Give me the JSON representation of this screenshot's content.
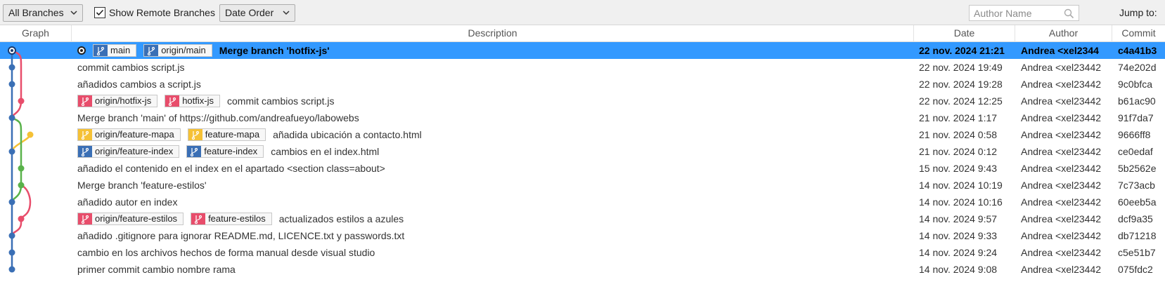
{
  "toolbar": {
    "branches_dropdown": "All Branches",
    "show_remote_label": "Show Remote Branches",
    "show_remote_checked": true,
    "order_dropdown": "Date Order",
    "author_placeholder": "Author Name",
    "jump_to_label": "Jump to:"
  },
  "columns": {
    "graph": "Graph",
    "description": "Description",
    "date": "Date",
    "author": "Author",
    "commit": "Commit"
  },
  "colors": {
    "selection": "#3399ff",
    "blue": "#3a6fb5",
    "pink": "#e84d6b",
    "yellow": "#f5c136",
    "green": "#59b24a"
  },
  "commits": [
    {
      "head": true,
      "refs": [
        {
          "name": "main",
          "color": "#3a6fb5",
          "icon": "branch-icon"
        },
        {
          "name": "origin/main",
          "color": "#3a6fb5",
          "icon": "branch-icon"
        }
      ],
      "message": "Merge branch 'hotfix-js'",
      "date": "22 nov. 2024 21:21",
      "author": "Andrea <xel2344",
      "commit": "c4a41b3"
    },
    {
      "refs": [],
      "message": "commit cambios script.js",
      "date": "22 nov. 2024 19:49",
      "author": "Andrea <xel23442",
      "commit": "74e202d"
    },
    {
      "refs": [],
      "message": "añadidos cambios a script.js",
      "date": "22 nov. 2024 19:28",
      "author": "Andrea <xel23442",
      "commit": "9c0bfca"
    },
    {
      "refs": [
        {
          "name": "origin/hotfix-js",
          "color": "#e84d6b",
          "icon": "branch-icon"
        },
        {
          "name": "hotfix-js",
          "color": "#e84d6b",
          "icon": "branch-icon"
        }
      ],
      "message": "commit cambios script.js",
      "date": "22 nov. 2024 12:25",
      "author": "Andrea <xel23442",
      "commit": "b61ac90"
    },
    {
      "refs": [],
      "message": "Merge branch 'main' of https://github.com/andreafueyo/labowebs",
      "date": "21 nov. 2024 1:17",
      "author": "Andrea <xel23442",
      "commit": "91f7da7"
    },
    {
      "refs": [
        {
          "name": "origin/feature-mapa",
          "color": "#f5c136",
          "icon": "branch-icon"
        },
        {
          "name": "feature-mapa",
          "color": "#f5c136",
          "icon": "branch-icon"
        }
      ],
      "message": "añadida ubicación a contacto.html",
      "date": "21 nov. 2024 0:58",
      "author": "Andrea <xel23442",
      "commit": "9666ff8"
    },
    {
      "refs": [
        {
          "name": "origin/feature-index",
          "color": "#3a6fb5",
          "icon": "branch-icon"
        },
        {
          "name": "feature-index",
          "color": "#3a6fb5",
          "icon": "branch-icon"
        }
      ],
      "message": "cambios en el index.html",
      "date": "21 nov. 2024 0:12",
      "author": "Andrea <xel23442",
      "commit": "ce0edaf"
    },
    {
      "refs": [],
      "message": "añadido el contenido en el index en el apartado <section class=about>",
      "date": "15 nov. 2024 9:43",
      "author": "Andrea <xel23442",
      "commit": "5b2562e"
    },
    {
      "refs": [],
      "message": "Merge branch 'feature-estilos'",
      "date": "14 nov. 2024 10:19",
      "author": "Andrea <xel23442",
      "commit": "7c73acb"
    },
    {
      "refs": [],
      "message": "añadido autor en index",
      "date": "14 nov. 2024 10:16",
      "author": "Andrea <xel23442",
      "commit": "60eeb5a"
    },
    {
      "refs": [
        {
          "name": "origin/feature-estilos",
          "color": "#e84d6b",
          "icon": "branch-icon"
        },
        {
          "name": "feature-estilos",
          "color": "#e84d6b",
          "icon": "branch-icon"
        }
      ],
      "message": "actualizados estilos a azules",
      "date": "14 nov. 2024 9:57",
      "author": "Andrea <xel23442",
      "commit": "dcf9a35"
    },
    {
      "refs": [],
      "message": "añadido .gitignore para ignorar README.md, LICENCE.txt y passwords.txt",
      "date": "14 nov. 2024 9:33",
      "author": "Andrea <xel23442",
      "commit": "db71218"
    },
    {
      "refs": [],
      "message": "cambio en los archivos hechos de forma manual desde visual studio",
      "date": "14 nov. 2024 9:24",
      "author": "Andrea <xel23442",
      "commit": "c5e51b7"
    },
    {
      "refs": [],
      "message": "primer commit cambio nombre rama",
      "date": "14 nov. 2024 9:08",
      "author": "Andrea <xel23442",
      "commit": "075fdc2"
    }
  ]
}
